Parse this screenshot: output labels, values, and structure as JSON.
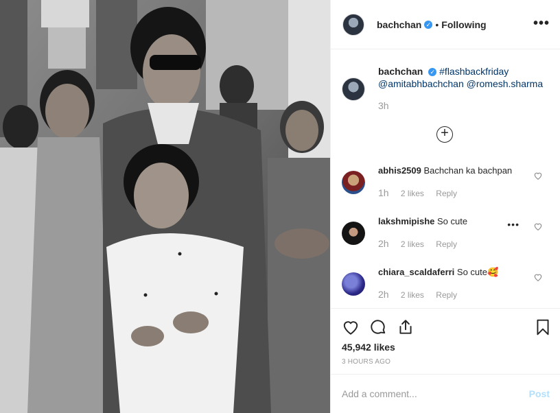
{
  "photo": {
    "alt_name": "black-and-white flashback photo"
  },
  "header": {
    "username": "bachchan",
    "verified_mark": "✓",
    "separator": "•",
    "follow_status": "Following",
    "more_icon": "•••"
  },
  "caption": {
    "username": "bachchan",
    "hashtag": "#flashbackfriday",
    "mention1": "@amitabhbachchan",
    "mention2": "@romesh.sharma",
    "time": "3h"
  },
  "load_more_icon": "+",
  "comments": [
    {
      "username": "abhis2509",
      "text": "Bachchan ka bachpan",
      "time": "1h",
      "likes": "2 likes",
      "reply": "Reply"
    },
    {
      "username": "lakshmipishe",
      "text": "So cute",
      "time": "2h",
      "likes": "2 likes",
      "reply": "Reply",
      "options": "•••"
    },
    {
      "username": "chiara_scaldaferri",
      "text": "So cute🥰",
      "time": "2h",
      "likes": "2 likes",
      "reply": "Reply"
    }
  ],
  "actions": {
    "icons": [
      "heart-icon",
      "comment-icon",
      "share-icon",
      "bookmark-icon"
    ],
    "likes": "45,942 likes",
    "posted_ago": "3 HOURS AGO"
  },
  "add_comment": {
    "placeholder": "Add a comment...",
    "post_label": "Post"
  },
  "colors": {
    "link": "#003569",
    "verified": "#3897f0",
    "post_disabled": "#b2dffc",
    "muted": "#999999"
  }
}
